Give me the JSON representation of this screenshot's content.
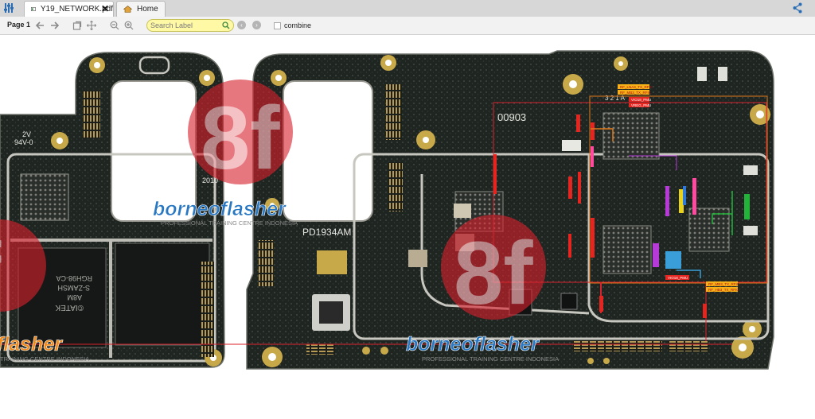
{
  "tabs": [
    {
      "label": "Y19_NETWORK.pdf",
      "icon": "pdf-file-icon",
      "closable": true,
      "active": true
    },
    {
      "label": "Home",
      "icon": "home-icon",
      "closable": false,
      "active": false
    }
  ],
  "toolbar": {
    "page_label": "Page 1",
    "search_placeholder": "Search Label",
    "combine_label": "combine",
    "combine_checked": false
  },
  "board": {
    "watermark_text": "borneoflasher",
    "watermark_text_partial": "flasher",
    "watermark_sub": "PROFESSIONAL TRAINING CENTRE INDONESIA",
    "watermark_sub_partial": "PROFESSIONAL TRAINING CENTRE INDONESIA",
    "silk_rating": "2V",
    "silk_code": "94V-0",
    "silk_year": "2010",
    "silk_model": "PD1934AM",
    "silk_serial": "00903",
    "silk_321": "3 2 1 A",
    "chip_brand": "©IATEK",
    "chip_text1": "A8M",
    "chip_text2": "S-ZAMSH",
    "chip_text3": "RGH98-CA",
    "net_labels": [
      "RF_LNA3_TX_RFIC",
      "RF_MB3_TX_RFIC",
      "VIO18_PMU",
      "VREG_PMU",
      "VIO18_PMU",
      "RF_MB3_TX_RFIC",
      "RF_HB3_TX_RFIC"
    ]
  },
  "colors": {
    "tabbar_bg": "#d7d7d7",
    "toolbar_bg": "#f2f2f2",
    "search_bg": "#fff9a6",
    "pcb": "#1f2521",
    "pad_gold": "#c8a94a",
    "watermark_red": "#d8222e",
    "watermark_blue": "#1f6fb5",
    "watermark_orange": "#ef8a1b"
  }
}
